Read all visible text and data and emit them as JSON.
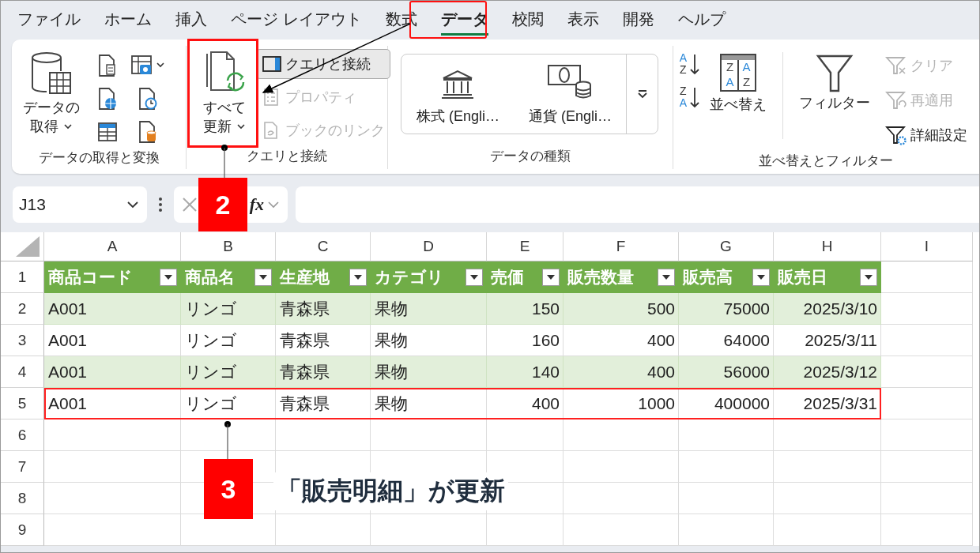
{
  "menu_tabs": [
    {
      "label": "ファイル",
      "selected": false
    },
    {
      "label": "ホーム",
      "selected": false
    },
    {
      "label": "挿入",
      "selected": false
    },
    {
      "label": "ページ レイアウト",
      "selected": false
    },
    {
      "label": "数式",
      "selected": false
    },
    {
      "label": "データ",
      "selected": true
    },
    {
      "label": "校閲",
      "selected": false
    },
    {
      "label": "表示",
      "selected": false
    },
    {
      "label": "開発",
      "selected": false
    },
    {
      "label": "ヘルプ",
      "selected": false
    }
  ],
  "ribbon_groups": [
    {
      "kind": "get",
      "label": "データの取得と変換",
      "large_button": {
        "lines": [
          "データの",
          "取得"
        ]
      }
    },
    {
      "kind": "query",
      "label": "クエリと接続",
      "large_button": {
        "lines": [
          "すべて",
          "更新"
        ]
      },
      "small_buttons": [
        {
          "label": "クエリと接続",
          "selected": true,
          "disabled": false
        },
        {
          "label": "プロパティ",
          "selected": false,
          "disabled": true
        },
        {
          "label": "ブックのリンク",
          "selected": false,
          "disabled": true
        }
      ]
    },
    {
      "kind": "types",
      "label": "データの種類",
      "items": [
        {
          "label": "株式 (Engli…"
        },
        {
          "label": "通貨 (Engli…"
        }
      ]
    },
    {
      "kind": "sort",
      "label": "並べ替えとフィルター",
      "sort_icons": [
        {
          "top": "A",
          "bottom": "Z"
        },
        {
          "top": "Z",
          "bottom": "A"
        }
      ],
      "sort_button": {
        "label": "並べ替え",
        "letters": [
          "Z",
          "A",
          "A",
          "Z"
        ]
      },
      "filter_label": "フィルター",
      "small_buttons": [
        {
          "label": "クリア",
          "disabled": true
        },
        {
          "label": "再適用",
          "disabled": true
        },
        {
          "label": "詳細設定",
          "disabled": false
        }
      ]
    }
  ],
  "formula_bar": {
    "name_box": "J13",
    "function_label": "fx"
  },
  "sheet": {
    "columns": [
      {
        "label": "A",
        "kind": "text"
      },
      {
        "label": "B",
        "kind": "text"
      },
      {
        "label": "C",
        "kind": "text"
      },
      {
        "label": "D",
        "kind": "text"
      },
      {
        "label": "E",
        "kind": "number"
      },
      {
        "label": "F",
        "kind": "number"
      },
      {
        "label": "G",
        "kind": "number"
      },
      {
        "label": "H",
        "kind": "number"
      },
      {
        "label": "I"
      }
    ],
    "header_row": {
      "number": "1",
      "cells": [
        "商品コード",
        "商品名",
        "生産地",
        "カテゴリ",
        "売価",
        "販売数量",
        "販売高",
        "販売日"
      ]
    },
    "rows": [
      {
        "number": "2",
        "banded": true,
        "highlighted": false,
        "cells": [
          "A001",
          "リンゴ",
          "青森県",
          "果物",
          "150",
          "500",
          "75000",
          "2025/3/10"
        ]
      },
      {
        "number": "3",
        "banded": false,
        "highlighted": false,
        "cells": [
          "A001",
          "リンゴ",
          "青森県",
          "果物",
          "160",
          "400",
          "64000",
          "2025/3/11"
        ]
      },
      {
        "number": "4",
        "banded": true,
        "highlighted": false,
        "cells": [
          "A001",
          "リンゴ",
          "青森県",
          "果物",
          "140",
          "400",
          "56000",
          "2025/3/12"
        ]
      },
      {
        "number": "5",
        "banded": false,
        "highlighted": true,
        "cells": [
          "A001",
          "リンゴ",
          "青森県",
          "果物",
          "400",
          "1000",
          "400000",
          "2025/3/31"
        ]
      }
    ],
    "empty_rows": [
      "6",
      "7",
      "8",
      "9"
    ]
  },
  "annotations": [
    {
      "number": "2"
    },
    {
      "number": "3",
      "text": "「販売明細」が更新"
    }
  ]
}
